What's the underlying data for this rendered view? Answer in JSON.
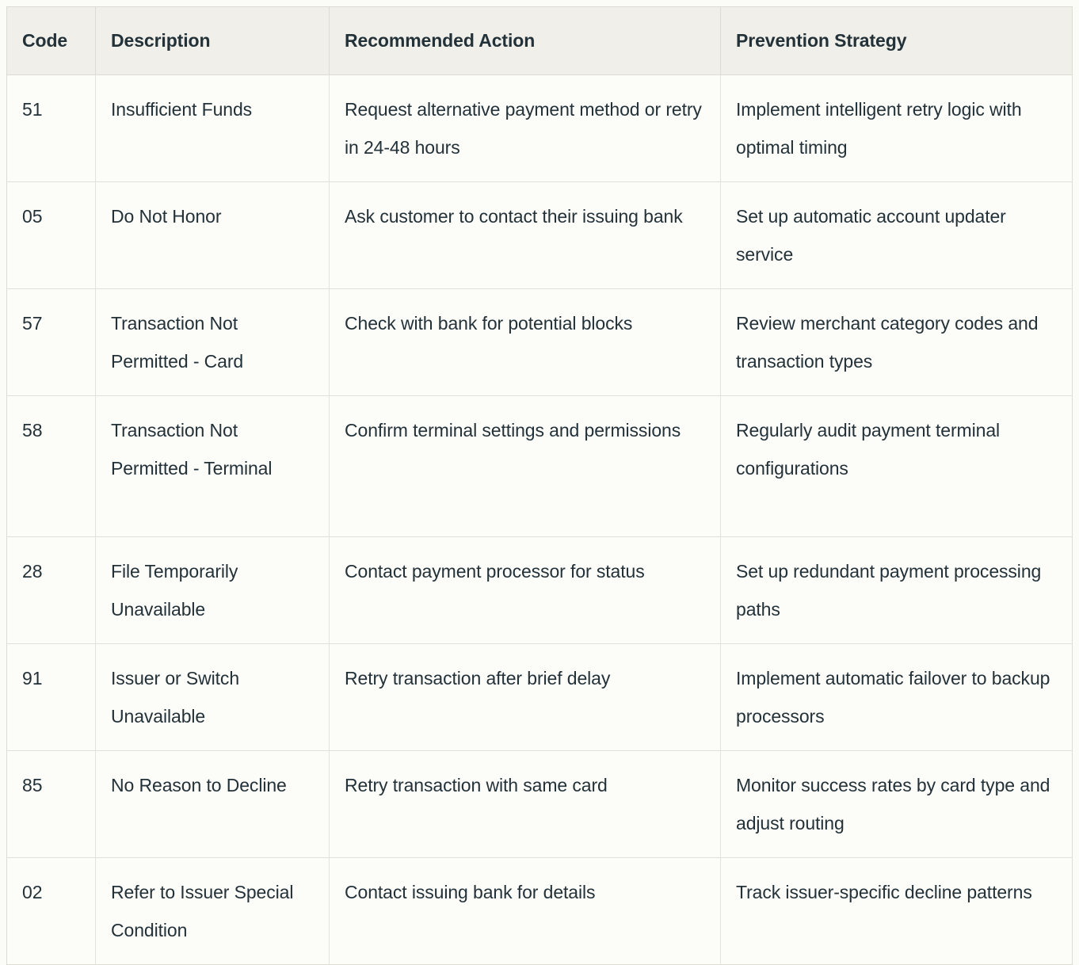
{
  "table": {
    "name": "card-decline-code-reference",
    "columns": [
      {
        "key": "code",
        "label": "Code"
      },
      {
        "key": "description",
        "label": "Description"
      },
      {
        "key": "action",
        "label": "Recommended Action"
      },
      {
        "key": "prevention",
        "label": "Prevention Strategy"
      }
    ],
    "rows": [
      {
        "code": "51",
        "description": "Insufficient Funds",
        "action": "Request alternative payment method or retry in 24-48 hours",
        "prevention": "Implement intelligent retry logic with optimal timing"
      },
      {
        "code": "05",
        "description": "Do Not Honor",
        "action": "Ask customer to contact their issuing bank",
        "prevention": "Set up automatic account updater service"
      },
      {
        "code": "57",
        "description": "Transaction Not Permitted - Card",
        "action": "Check with bank for potential blocks",
        "prevention": "Review merchant category codes and transaction types"
      },
      {
        "code": "58",
        "description": "Transaction Not Permitted - Terminal",
        "action": "Confirm terminal settings and permissions",
        "prevention": "Regularly audit payment terminal configurations"
      },
      {
        "code": "28",
        "description": "File Temporarily Unavailable",
        "action": "Contact payment processor for status",
        "prevention": "Set up redundant payment processing paths"
      },
      {
        "code": "91",
        "description": "Issuer or Switch Unavailable",
        "action": "Retry transaction after brief delay",
        "prevention": "Implement automatic failover to backup processors"
      },
      {
        "code": "85",
        "description": "No Reason to Decline",
        "action": "Retry transaction with same card",
        "prevention": "Monitor success rates by card type and adjust routing"
      },
      {
        "code": "02",
        "description": "Refer to Issuer Special Condition",
        "action": "Contact issuing bank for details",
        "prevention": "Track issuer-specific decline patterns"
      }
    ]
  },
  "colors": {
    "page_background": "#fbfbf7",
    "header_background": "#f0efe9",
    "cell_background": "#fcfcf9",
    "text": "#233138",
    "border": "#dcdcd4",
    "inner_border": "#e4e4dc"
  }
}
